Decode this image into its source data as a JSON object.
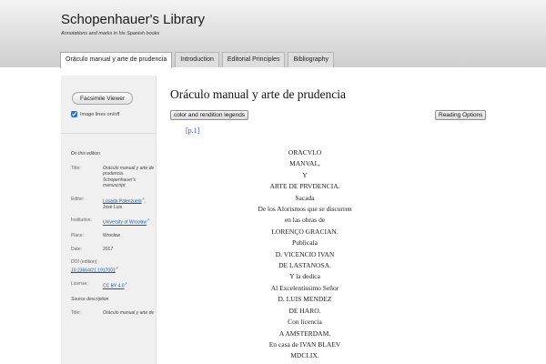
{
  "header": {
    "title": "Schopenhauer's Library",
    "subtitle": "Annotations and marks in his Spanish books"
  },
  "tabs": [
    {
      "label": "Oráculo manual y arte de prudencia"
    },
    {
      "label": "Introduction"
    },
    {
      "label": "Editorial Principles"
    },
    {
      "label": "Bibliography"
    }
  ],
  "sidebar": {
    "facsimile_button": "Facsimile Viewer",
    "image_lines_label": "Image lines on/off",
    "image_lines_checked": true,
    "edition": {
      "heading": "On this edition",
      "title_key": "Title:",
      "title_val": "Oráculo manual y arte de prudencia. Schopenhauer's manuscript",
      "editor_key": "Editor:",
      "editor_val": "Losada Palenzuela",
      "editor_rest": ", José Luis",
      "institution_key": "Institution:",
      "institution_val": "University of Wrocław",
      "place_key": "Place:",
      "place_val": "Wrocław",
      "date_key": "Date:",
      "date_val": "2017",
      "doi_key": "DOI (edition):",
      "doi_val": "10.23664/21.1917001",
      "license_key": "License:",
      "license_val": "CC BY 4.0",
      "source_heading": "Source description",
      "source_title_key": "Title:",
      "source_title_val": "Oráculo manual y arte de"
    }
  },
  "main": {
    "title": "Oráculo manual y arte de prudencia",
    "legend_button": "color and rendition legends",
    "reading_button": "Reading Options",
    "page_marker": "[p.1]",
    "lines": [
      "ORACVLO",
      "MANVAL,",
      "Y",
      "ARTE DE PRVDENCIA.",
      "Sacada",
      "De los Aforismos que se discurren",
      "en las obras de",
      "LORENÇO GRACIAN.",
      "Publicala",
      "D. VICENCIO IVAN",
      "DE LASTANOSA.",
      "Y la dedica",
      "Al Excelentissimo Señor",
      "D. LUIS MENDEZ",
      "DE HARO.",
      "Con licencia",
      "A AMSTERDAM,",
      "En casa de IVAN BLAEV",
      "MDCLIX."
    ]
  }
}
